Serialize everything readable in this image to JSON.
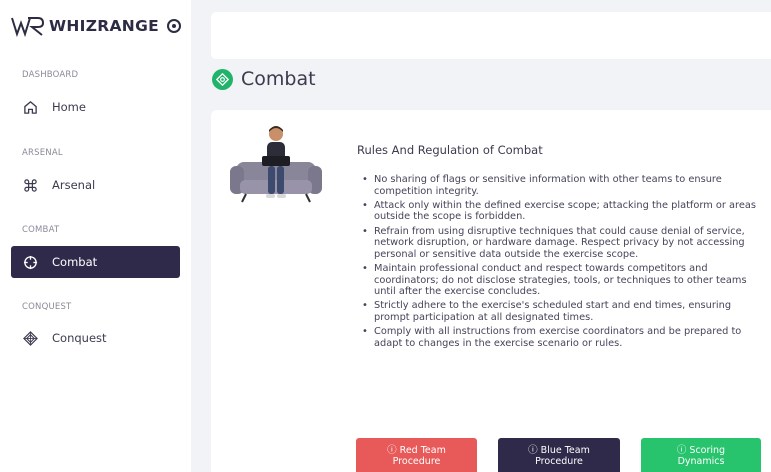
{
  "brand": {
    "name": "WHIZRANGE"
  },
  "sidebar": {
    "sections": [
      {
        "label": "DASHBOARD",
        "item": {
          "label": "Home",
          "icon": "home-icon"
        }
      },
      {
        "label": "ARSENAL",
        "item": {
          "label": "Arsenal",
          "icon": "command-icon"
        }
      },
      {
        "label": "COMBAT",
        "item": {
          "label": "Combat",
          "icon": "crosshair-icon",
          "active": true
        }
      },
      {
        "label": "CONQUEST",
        "item": {
          "label": "Conquest",
          "icon": "cube-icon"
        }
      }
    ]
  },
  "page": {
    "title": "Combat",
    "title_icon": "crosshair-icon",
    "accent": "#22b36b"
  },
  "rules": {
    "heading": "Rules And Regulation of Combat",
    "items": [
      "No sharing of flags or sensitive information with other teams to ensure competition integrity.",
      "Attack only within the defined exercise scope; attacking the platform or areas outside the scope is forbidden.",
      "Refrain from using disruptive techniques that could cause denial of service, network disruption, or hardware damage. Respect privacy by not accessing personal or sensitive data outside the exercise scope.",
      "Maintain professional conduct and respect towards competitors and coordinators; do not disclose strategies, tools, or techniques to other teams until after the exercise concludes.",
      "Strictly adhere to the exercise's scheduled start and end times, ensuring prompt participation at all designated times.",
      "Comply with all instructions from exercise coordinators and be prepared to adapt to changes in the exercise scenario or rules."
    ]
  },
  "buttons": {
    "red": {
      "line1": "ⓘ Red Team",
      "line2": "Procedure",
      "color": "#e85a5a"
    },
    "blue": {
      "line1": "ⓘ Blue Team",
      "line2": "Procedure",
      "color": "#2f2a4a"
    },
    "green": {
      "line1": "ⓘ Scoring",
      "line2": "Dynamics",
      "color": "#28c46d"
    }
  }
}
